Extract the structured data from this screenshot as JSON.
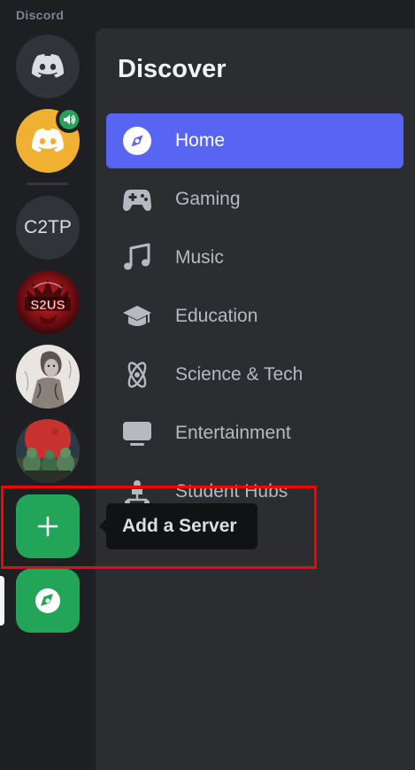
{
  "app": {
    "title": "Discord"
  },
  "servers": {
    "c2tp_label": "C2TP",
    "s2us_label": "S2US"
  },
  "discover": {
    "title": "Discover",
    "items": [
      {
        "label": "Home",
        "icon": "compass-icon",
        "active": true
      },
      {
        "label": "Gaming",
        "icon": "gamepad-icon"
      },
      {
        "label": "Music",
        "icon": "music-note-icon"
      },
      {
        "label": "Education",
        "icon": "graduation-cap-icon"
      },
      {
        "label": "Science & Tech",
        "icon": "atom-icon"
      },
      {
        "label": "Entertainment",
        "icon": "monitor-icon"
      },
      {
        "label": "Student Hubs",
        "icon": "student-hub-icon"
      }
    ]
  },
  "tooltip": {
    "text": "Add a Server"
  },
  "colors": {
    "background": "#1e1f22",
    "panel": "#2b2d31",
    "accent": "#5865f2",
    "green": "#23a559",
    "voice_avatar": "#f0b132",
    "highlight_box": "#ff0000"
  }
}
